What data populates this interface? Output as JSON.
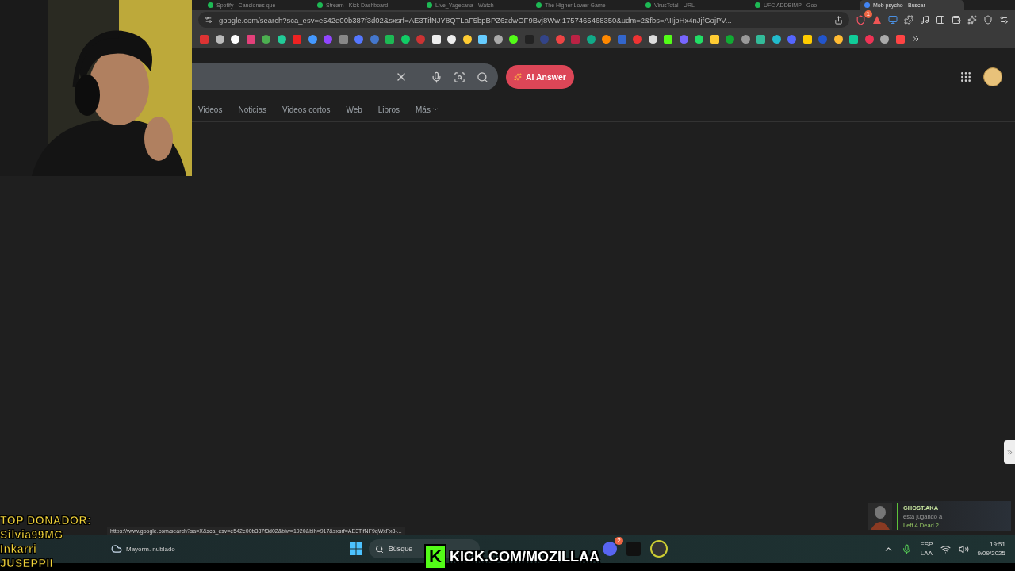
{
  "browser": {
    "tabs": [
      {
        "title": "Spotify - Canciones que",
        "selected": false
      },
      {
        "title": "Stream - Kick Dashboard",
        "selected": false
      },
      {
        "title": "Live_Yagecana - Watch",
        "selected": false
      },
      {
        "title": "The Higher Lower Game",
        "selected": false
      },
      {
        "title": "VirusTotal - URL",
        "selected": false
      },
      {
        "title": "UFC ADDBIMP - Goo",
        "selected": false
      },
      {
        "title": "Mob psycho - Buscar",
        "selected": true
      }
    ],
    "address": "google.com/search?sca_esv=e542e00b387f3d02&sxsrf=AE3TifNJY8QTLaF5bpBPZ6zdwOF9Bvj8Ww:1757465468350&udm=2&fbs=AIIjpHx4nJjfGojPV...",
    "brave_badge": "1",
    "status_url": "https://www.google.com/search?sa=X&sca_esv=e542e00b387f3d02&biw=1920&bih=917&sxsrf=AE3TifNF9qWxFx8-..."
  },
  "search": {
    "ai_button": "AI Answer",
    "nav": [
      "Videos",
      "Noticias",
      "Videos cortos",
      "Web",
      "Libros",
      "Más"
    ]
  },
  "overlay": {
    "donor_title": "TOP DONADOR:",
    "donors": [
      "Silvia99MG",
      "Inkarri",
      "JUSEPPII"
    ],
    "kick_letter": "K",
    "kick_text": "KICK.COM/MOZILLAA"
  },
  "notification": {
    "name": "GHOST.AKA",
    "status": "está jugando a",
    "game": "Left 4 Dead 2"
  },
  "taskbar": {
    "weather": "Mayorm. nublado",
    "search_placeholder": "Búsque",
    "discord_badge": "2",
    "lang_top": "ESP",
    "lang_bottom": "LAA",
    "time": "19:51",
    "date": "9/09/2025"
  }
}
